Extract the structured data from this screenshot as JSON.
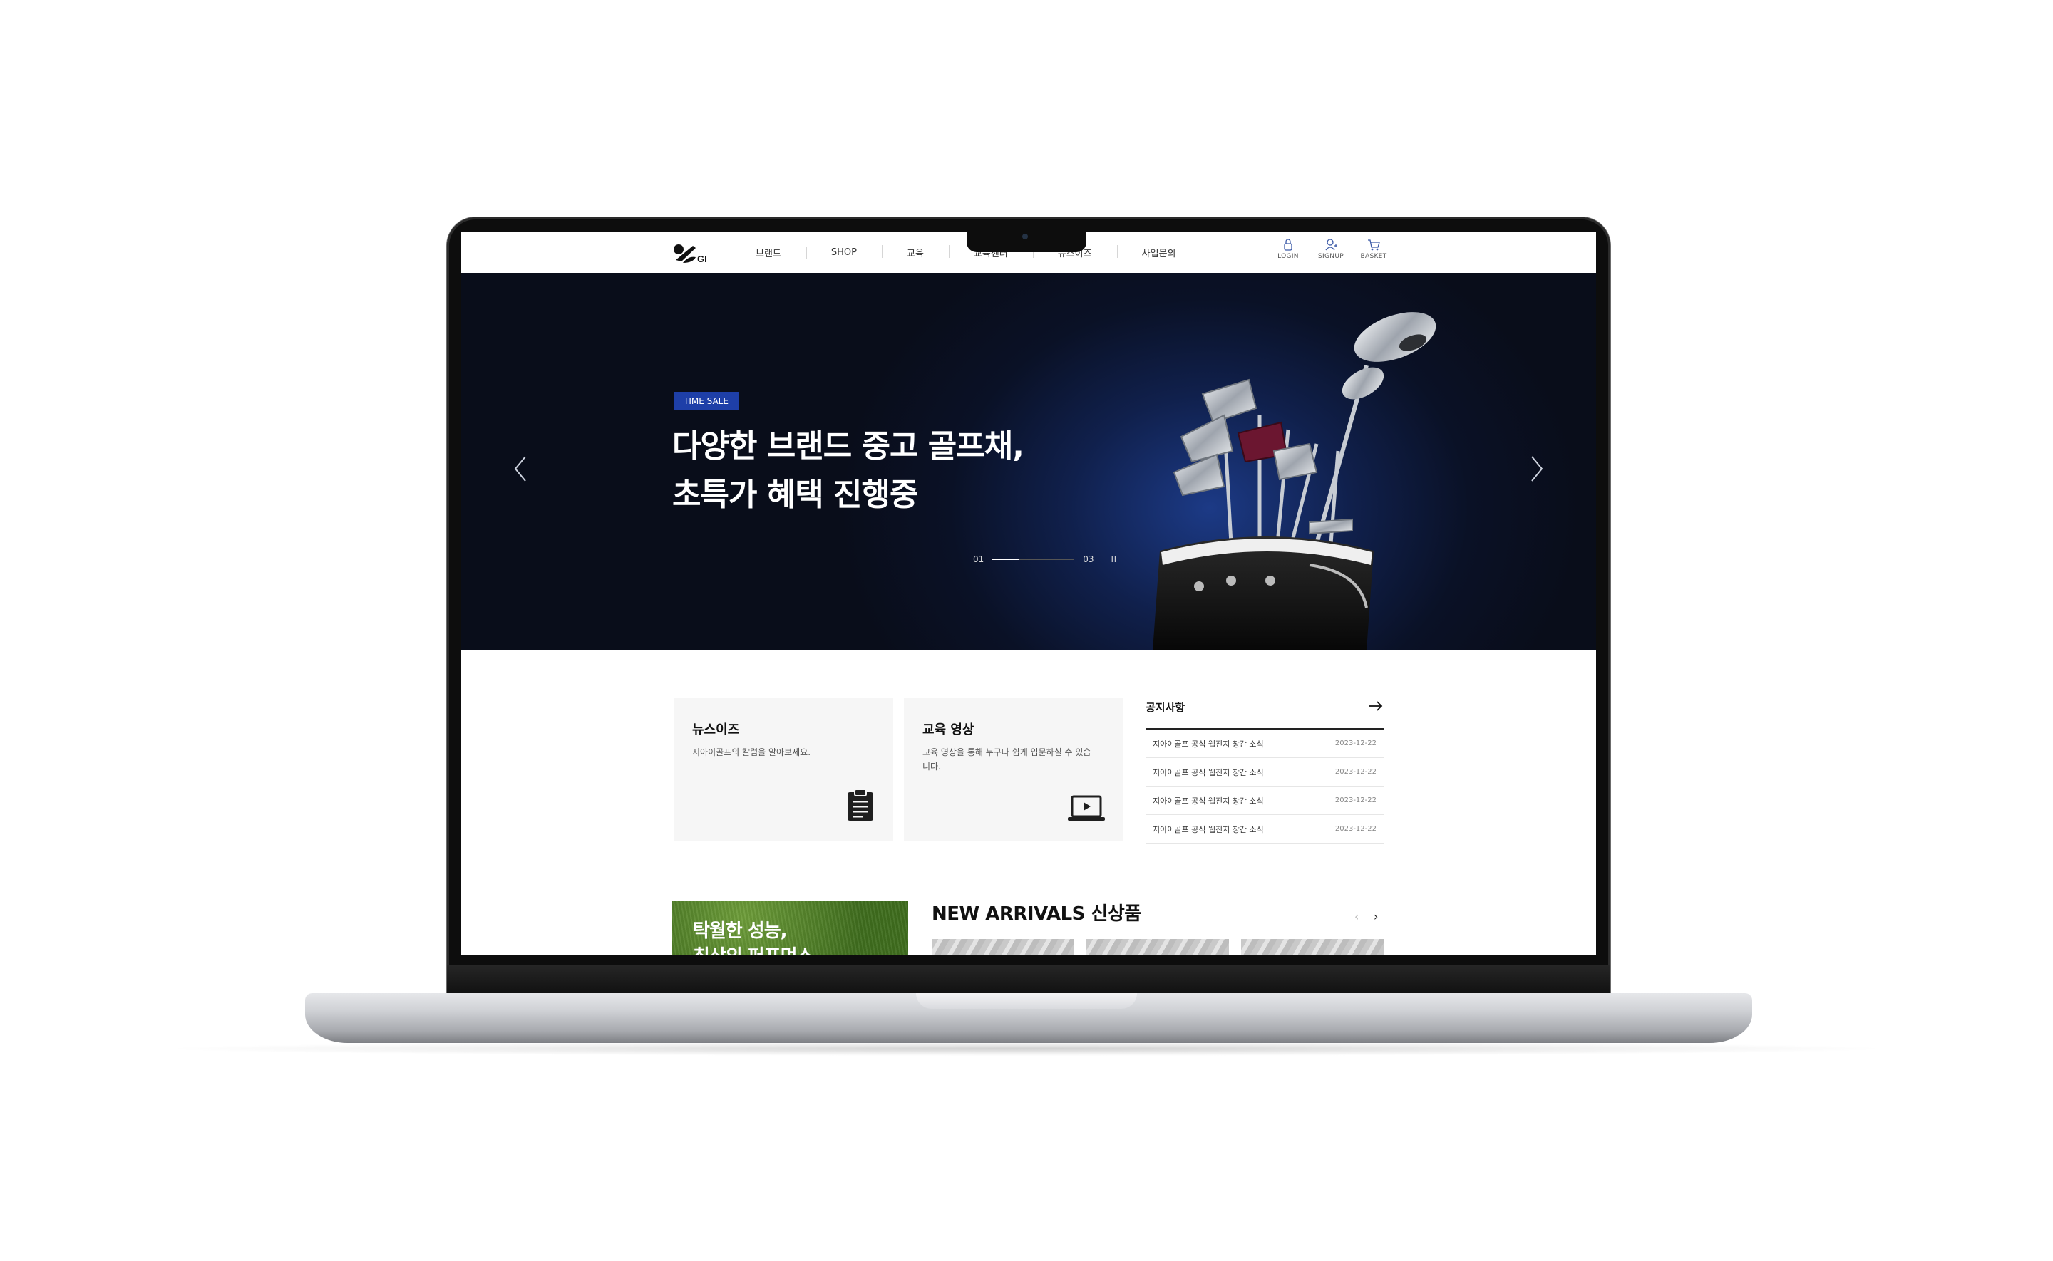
{
  "header": {
    "logo_text": "GI",
    "nav": [
      "브랜드",
      "SHOP",
      "교육",
      "교육센터",
      "뉴스이즈",
      "사업문의"
    ],
    "utils": [
      {
        "label": "LOGIN",
        "icon": "lock-icon"
      },
      {
        "label": "SIGNUP",
        "icon": "user-plus-icon"
      },
      {
        "label": "BASKET",
        "icon": "cart-icon"
      }
    ]
  },
  "hero": {
    "badge": "TIME SALE",
    "title_line1": "다양한 브랜드 중고 골프채,",
    "title_line2": "초특가 혜택 진행중",
    "pager_current": "01",
    "pager_total": "03",
    "pager_pause": "II"
  },
  "cards": [
    {
      "title": "뉴스이즈",
      "desc": "지아이골프의 칼럼을 알아보세요.",
      "icon": "clipboard-icon"
    },
    {
      "title": "교육 영상",
      "desc": "교육 영상을 통해 누구나 쉽게 입문하실 수 있습니다.",
      "icon": "laptop-play-icon"
    }
  ],
  "notice": {
    "title": "공지사항",
    "rows": [
      {
        "text": "지아이골프 공식 웹진지 창간 소식",
        "date": "2023-12-22"
      },
      {
        "text": "지아이골프 공식 웹진지 창간 소식",
        "date": "2023-12-22"
      },
      {
        "text": "지아이골프 공식 웹진지 창간 소식",
        "date": "2023-12-22"
      },
      {
        "text": "지아이골프 공식 웹진지 창간 소식",
        "date": "2023-12-22"
      }
    ]
  },
  "promo": {
    "line1": "탁월한 성능,",
    "line2": "최상의 퍼포먼스"
  },
  "arrivals": {
    "title": "NEW ARRIVALS 신상품",
    "prev": "‹",
    "next": "›"
  },
  "colors": {
    "badge": "#1e3fa8",
    "hero_bg": "#0a1126"
  }
}
